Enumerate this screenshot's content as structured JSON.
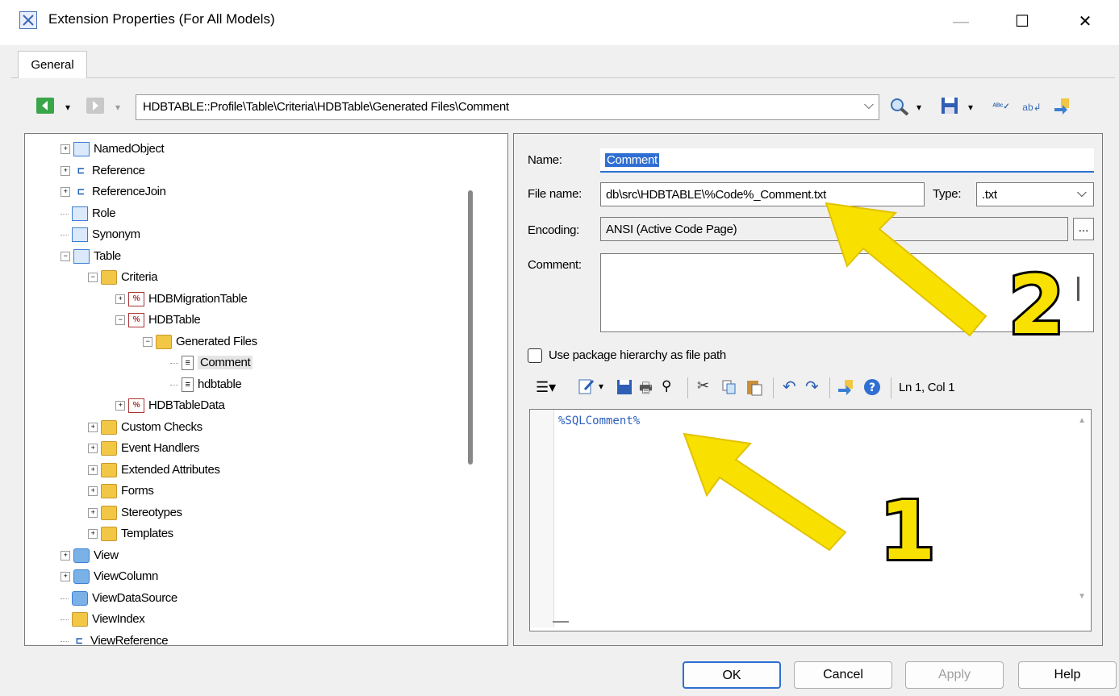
{
  "window": {
    "title": "Extension Properties (For All Models)",
    "minimize_glyph": "—",
    "maximize_glyph": "☐",
    "close_glyph": "✕"
  },
  "tabs": [
    {
      "label": "General",
      "active": true
    }
  ],
  "toolbar": {
    "path": "HDBTABLE::Profile\\Table\\Criteria\\HDBTable\\Generated Files\\Comment",
    "path_dropdown_glyph": "⌵",
    "icons": [
      "back-arrow-icon",
      "forward-arrow-icon",
      "find-icon",
      "save-icon",
      "spellcheck-icon",
      "replace-icon",
      "insert-icon"
    ]
  },
  "tree": {
    "items": [
      {
        "label": "NamedObject",
        "icon": "table-icon",
        "level": 0,
        "expander": "+"
      },
      {
        "label": "Reference",
        "icon": "reference-icon",
        "level": 0,
        "expander": "+"
      },
      {
        "label": "ReferenceJoin",
        "icon": "reference-icon",
        "level": 0,
        "expander": "+"
      },
      {
        "label": "Role",
        "icon": "role-icon",
        "level": 0,
        "expander": ""
      },
      {
        "label": "Synonym",
        "icon": "synonym-icon",
        "level": 0,
        "expander": ""
      },
      {
        "label": "Table",
        "icon": "table-icon",
        "level": 0,
        "expander": "−"
      },
      {
        "label": "Criteria",
        "icon": "folder-icon",
        "level": 1,
        "expander": "−"
      },
      {
        "label": "HDBMigrationTable",
        "icon": "criteria-icon",
        "level": 2,
        "expander": "+"
      },
      {
        "label": "HDBTable",
        "icon": "criteria-icon",
        "level": 2,
        "expander": "−"
      },
      {
        "label": "Generated Files",
        "icon": "folder-icon",
        "level": 3,
        "expander": "−"
      },
      {
        "label": "Comment",
        "icon": "file-icon",
        "level": 4,
        "expander": "",
        "selected": true
      },
      {
        "label": "hdbtable",
        "icon": "file-icon",
        "level": 4,
        "expander": ""
      },
      {
        "label": "HDBTableData",
        "icon": "criteria-icon",
        "level": 2,
        "expander": "+"
      },
      {
        "label": "Custom Checks",
        "icon": "folder-icon",
        "level": 1,
        "expander": "+"
      },
      {
        "label": "Event Handlers",
        "icon": "folder-icon",
        "level": 1,
        "expander": "+"
      },
      {
        "label": "Extended Attributes",
        "icon": "folder-icon",
        "level": 1,
        "expander": "+"
      },
      {
        "label": "Forms",
        "icon": "folder-icon",
        "level": 1,
        "expander": "+"
      },
      {
        "label": "Stereotypes",
        "icon": "folder-icon",
        "level": 1,
        "expander": "+"
      },
      {
        "label": "Templates",
        "icon": "folder-icon",
        "level": 1,
        "expander": "+"
      },
      {
        "label": "View",
        "icon": "view-icon",
        "level": 0,
        "expander": "+"
      },
      {
        "label": "ViewColumn",
        "icon": "view-icon",
        "level": 0,
        "expander": "+"
      },
      {
        "label": "ViewDataSource",
        "icon": "view-icon",
        "level": 0,
        "expander": ""
      },
      {
        "label": "ViewIndex",
        "icon": "index-icon",
        "level": 0,
        "expander": ""
      },
      {
        "label": "ViewReference",
        "icon": "reference-icon",
        "level": 0,
        "expander": ""
      }
    ]
  },
  "form": {
    "name_label": "Name:",
    "name_value": "Comment",
    "filename_label": "File name:",
    "filename_value": "db\\src\\HDBTABLE\\%Code%_Comment.txt",
    "type_label": "Type:",
    "type_value": ".txt",
    "type_dropdown_glyph": "⌵",
    "encoding_label": "Encoding:",
    "encoding_value": "ANSI (Active Code Page)",
    "encoding_button": "...",
    "comment_label": "Comment:",
    "comment_value": "",
    "use_package_label": "Use package hierarchy as file path",
    "use_package_checked": false
  },
  "editor": {
    "status": "Ln 1, Col 1",
    "content": "%SQLComment%"
  },
  "annotations": {
    "one": "1",
    "two": "2"
  },
  "buttons": {
    "ok": "OK",
    "cancel": "Cancel",
    "apply": "Apply",
    "help": "Help"
  },
  "colors": {
    "selection": "#2f6fd3",
    "annotation": "#f8e100",
    "editor_text": "#2b5fbf"
  }
}
